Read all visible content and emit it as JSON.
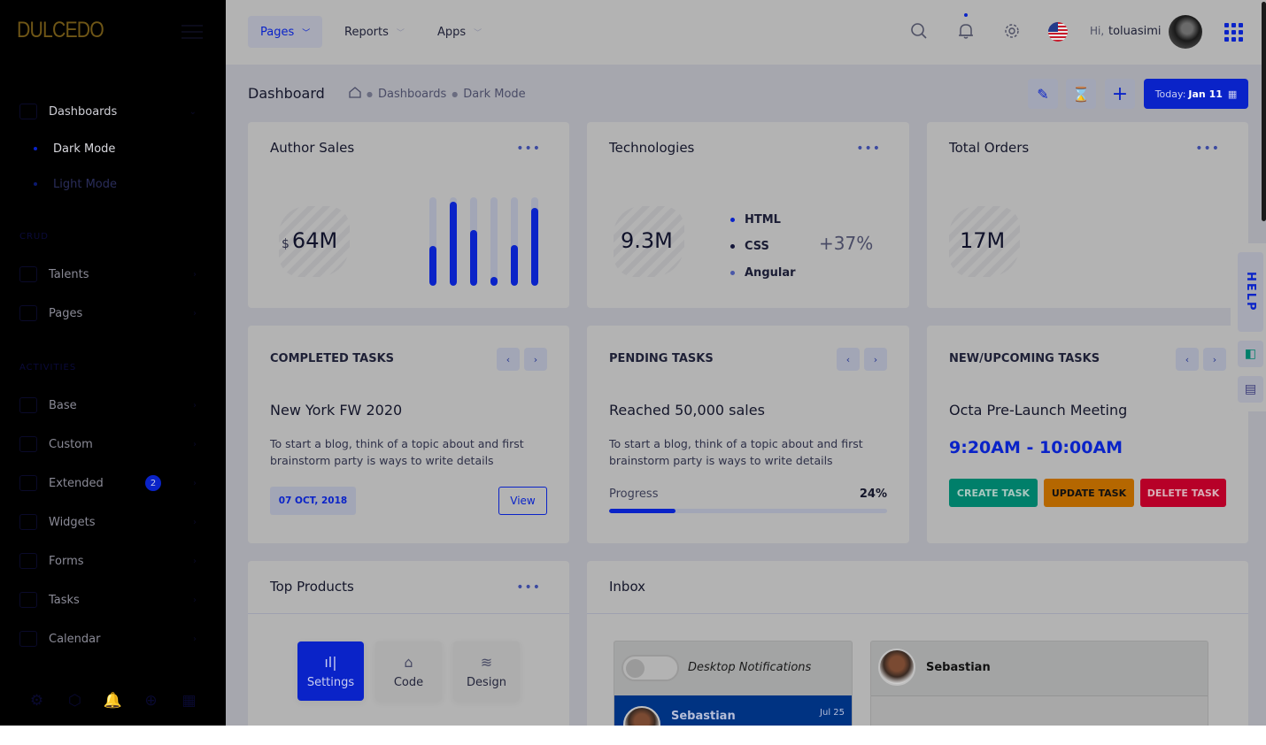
{
  "sidebar": {
    "logo": "DULCEDO",
    "dashboards": {
      "label": "Dashboards",
      "children": [
        {
          "label": "Dark Mode",
          "active": true
        },
        {
          "label": "Light Mode",
          "active": false
        }
      ]
    },
    "sections": [
      {
        "title": "CRUD",
        "items": [
          {
            "label": "Talents"
          },
          {
            "label": "Pages"
          }
        ]
      },
      {
        "title": "ACTIVITIES",
        "items": [
          {
            "label": "Base"
          },
          {
            "label": "Custom"
          },
          {
            "label": "Extended",
            "badge": "2"
          },
          {
            "label": "Widgets"
          },
          {
            "label": "Forms"
          },
          {
            "label": "Tasks"
          },
          {
            "label": "Calendar"
          }
        ]
      }
    ],
    "footer_icons": [
      "gear-icon",
      "box-icon",
      "bell-icon",
      "plus-circle-icon",
      "calendar-icon"
    ],
    "footer_glyphs": [
      "⚙",
      "⬡",
      "🔔",
      "⊕",
      "▦"
    ]
  },
  "header": {
    "menu": [
      {
        "label": "Pages",
        "active": true
      },
      {
        "label": "Reports"
      },
      {
        "label": "Apps"
      }
    ],
    "greeting": "Hi,",
    "username": "toluasimi"
  },
  "subheader": {
    "title": "Dashboard",
    "breadcrumb": [
      "Dashboards",
      "Dark Mode"
    ],
    "today_label": "Today:",
    "today_value": "Jan 11"
  },
  "cards": {
    "author_sales": {
      "title": "Author Sales",
      "currency": "$",
      "value": "64M",
      "bar_levels_pct": [
        45,
        95,
        63,
        10,
        46,
        88
      ]
    },
    "technologies": {
      "title": "Technologies",
      "value": "9.3M",
      "legend": [
        {
          "label": "HTML",
          "color": "#0a23c8"
        },
        {
          "label": "CSS",
          "color": "#14163a"
        },
        {
          "label": "Angular",
          "color": "#4a58a8"
        }
      ],
      "change": "+37%"
    },
    "total_orders": {
      "title": "Total Orders",
      "value": "17M"
    },
    "completed_tasks": {
      "heading": "COMPLETED TASKS",
      "title": "New York FW 2020",
      "description": "To start a blog, think of a topic about and first brainstorm party is ways to write details",
      "date": "07 OCT, 2018",
      "view_label": "View"
    },
    "pending_tasks": {
      "heading": "PENDING TASKS",
      "title": "Reached 50,000 sales",
      "description": "To start a blog, think of a topic about and first brainstorm party is ways to write details",
      "progress_label": "Progress",
      "progress_text": "24%",
      "progress_pct": 24
    },
    "upcoming_tasks": {
      "heading": "NEW/UPCOMING TASKS",
      "title": "Octa Pre-Launch Meeting",
      "time": "9:20AM - 10:00AM",
      "create_label": "CREATE TASK",
      "update_label": "UPDATE TASK",
      "delete_label": "DELETE TASK"
    },
    "top_products": {
      "title": "Top Products",
      "tiles": [
        {
          "label": "Settings",
          "active": true
        },
        {
          "label": "Code"
        },
        {
          "label": "Design"
        }
      ]
    },
    "inbox": {
      "title": "Inbox",
      "notifications_label": "Desktop Notifications",
      "list": [
        {
          "name": "Sebastian",
          "date": "Jul 25"
        }
      ],
      "conversation_name": "Sebastian"
    }
  },
  "help_panel": {
    "label": "HELP"
  },
  "colors": {
    "accent": "#0a23c8",
    "create": "#007f6a",
    "update": "#b56700",
    "delete": "#b70028"
  }
}
